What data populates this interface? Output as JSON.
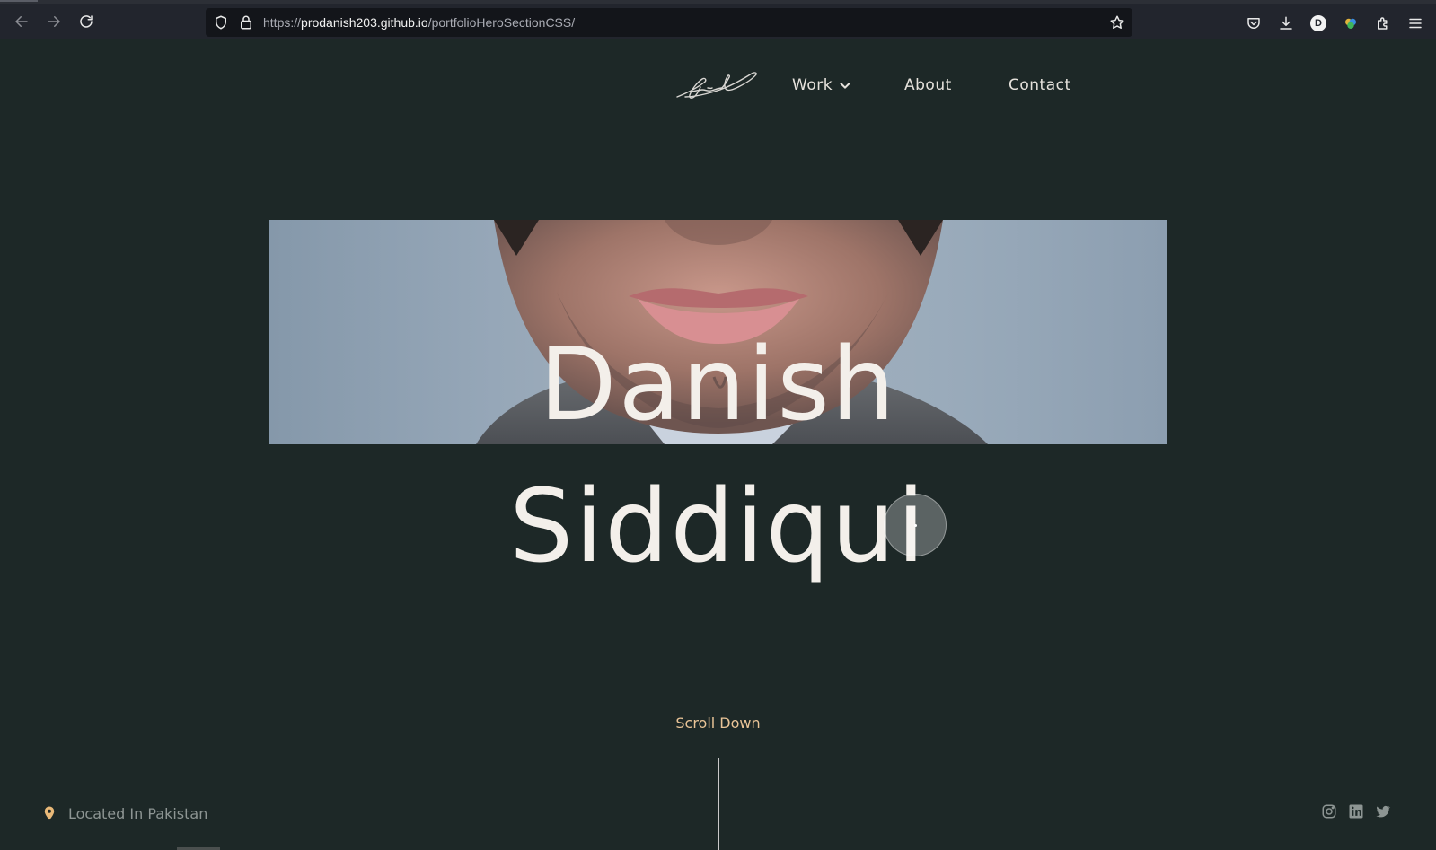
{
  "browser": {
    "url_scheme": "https://",
    "url_host": "prodanish203.github.io",
    "url_path": "/portfolioHeroSectionCSS/",
    "profile_initial": "D",
    "icons": [
      "back-icon",
      "forward-icon",
      "reload-icon",
      "shield-icon",
      "lock-icon",
      "bookmark-star-icon",
      "pocket-icon",
      "downloads-icon",
      "profile-avatar",
      "extension-icon",
      "puzzle-icon",
      "menu-icon"
    ]
  },
  "nav": {
    "work": "Work",
    "about": "About",
    "contact": "Contact"
  },
  "hero": {
    "first_name": "Danish",
    "last_name": "Siddiqui"
  },
  "scroll_label": "Scroll Down",
  "footer": {
    "location": "Located In Pakistan"
  },
  "colors": {
    "background": "#1d2827",
    "text": "#f3efea",
    "accent": "#e9c497",
    "muted": "#8d9593"
  }
}
